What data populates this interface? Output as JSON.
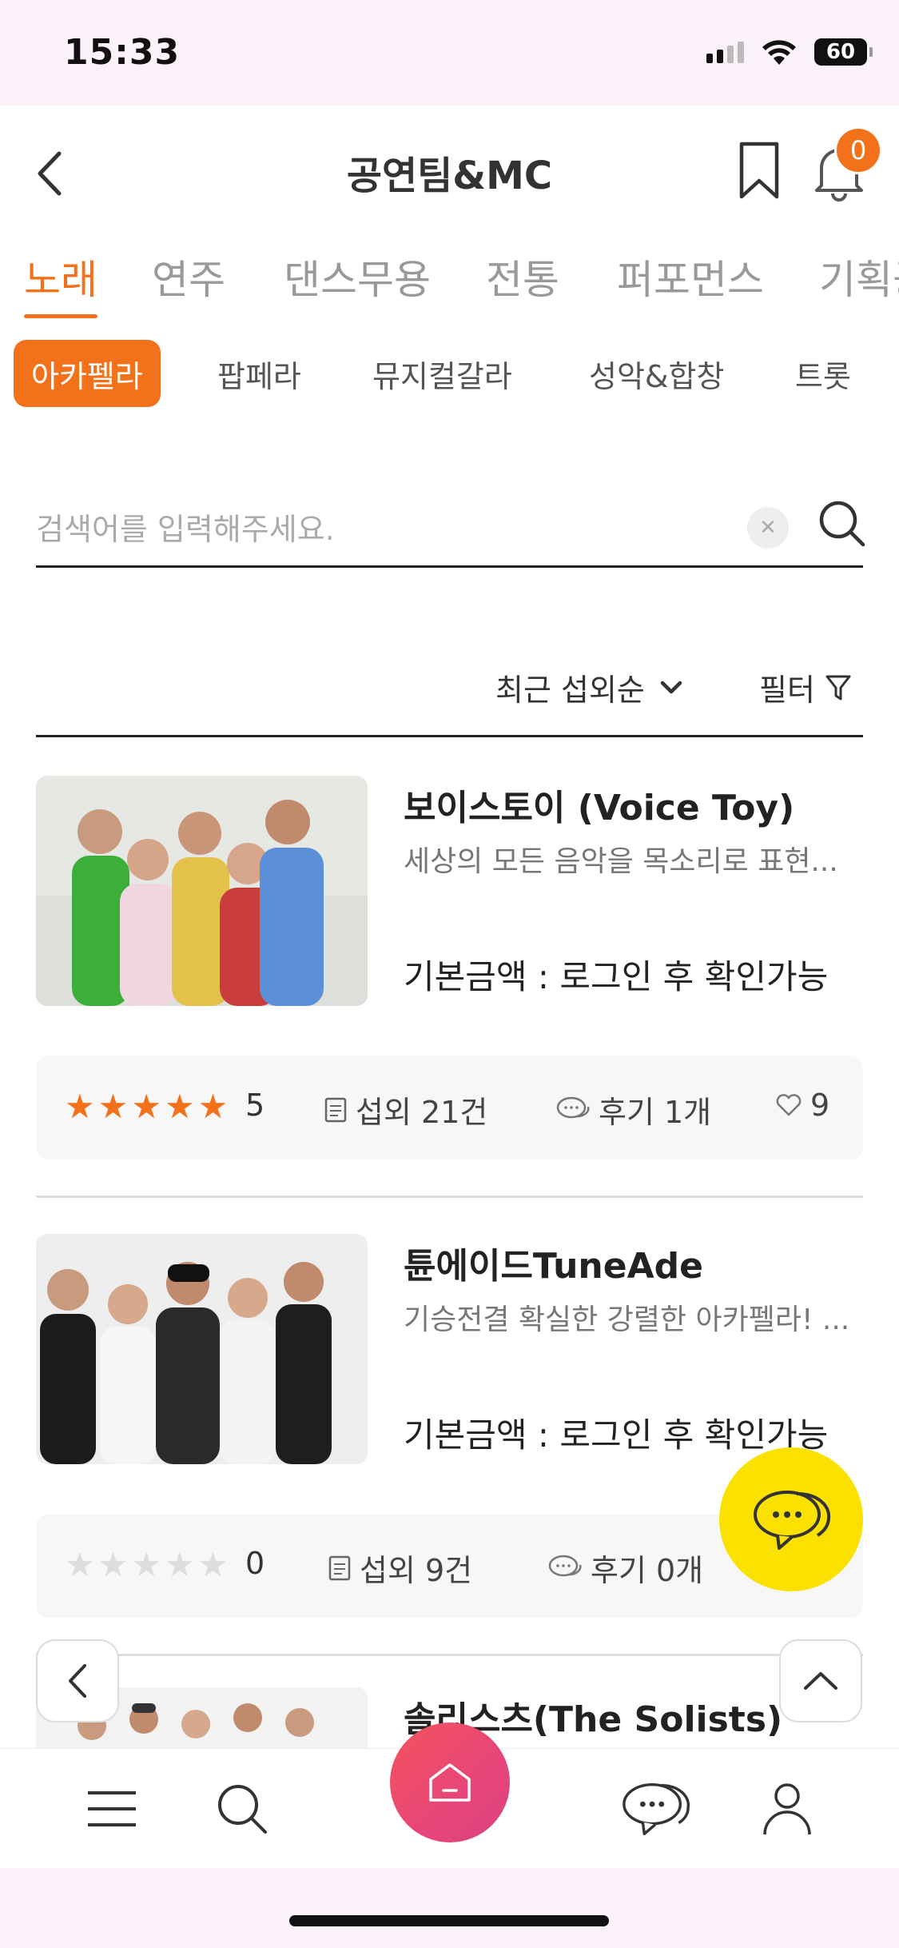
{
  "status_bar": {
    "time": "15:33",
    "battery": "60"
  },
  "header": {
    "title": "공연팀&MC",
    "notification_count": "0"
  },
  "category_tabs": [
    {
      "label": "노래",
      "active": true
    },
    {
      "label": "연주",
      "active": false
    },
    {
      "label": "댄스무용",
      "active": false
    },
    {
      "label": "전통",
      "active": false
    },
    {
      "label": "퍼포먼스",
      "active": false
    },
    {
      "label": "기획공",
      "active": false
    }
  ],
  "sub_tabs": [
    {
      "label": "아카펠라",
      "active": true
    },
    {
      "label": "팝페라",
      "active": false
    },
    {
      "label": "뮤지컬갈라",
      "active": false
    },
    {
      "label": "성악&합창",
      "active": false
    },
    {
      "label": "트롯",
      "active": false
    }
  ],
  "search": {
    "placeholder": "검색어를 입력해주세요.",
    "value": ""
  },
  "sort": {
    "label": "최근 섭외순",
    "filter_label": "필터"
  },
  "items": [
    {
      "title": "보이스토이 (Voice Toy)",
      "description": "세상의 모든 음악을 목소리로 표현...",
      "price": "기본금액 : 로그인 후 확인가능",
      "rating_stars": 5,
      "rating": "5",
      "bookings": "섭외 21건",
      "reviews": "후기 1개",
      "likes": "9"
    },
    {
      "title": "튠에이드TuneAde",
      "description": "기승전결 확실한 강렬한 아카펠라! ...",
      "price": "기본금액 : 로그인 후 확인가능",
      "rating_stars": 0,
      "rating": "0",
      "bookings": "섭외 9건",
      "reviews": "후기 0개",
      "likes": ""
    },
    {
      "title": "솔리스츠(The Solists)"
    }
  ],
  "colors": {
    "accent": "#f4711b",
    "chat_fab": "#fae100",
    "home_gradient_start": "#f2545b",
    "home_gradient_end": "#d8447f"
  }
}
